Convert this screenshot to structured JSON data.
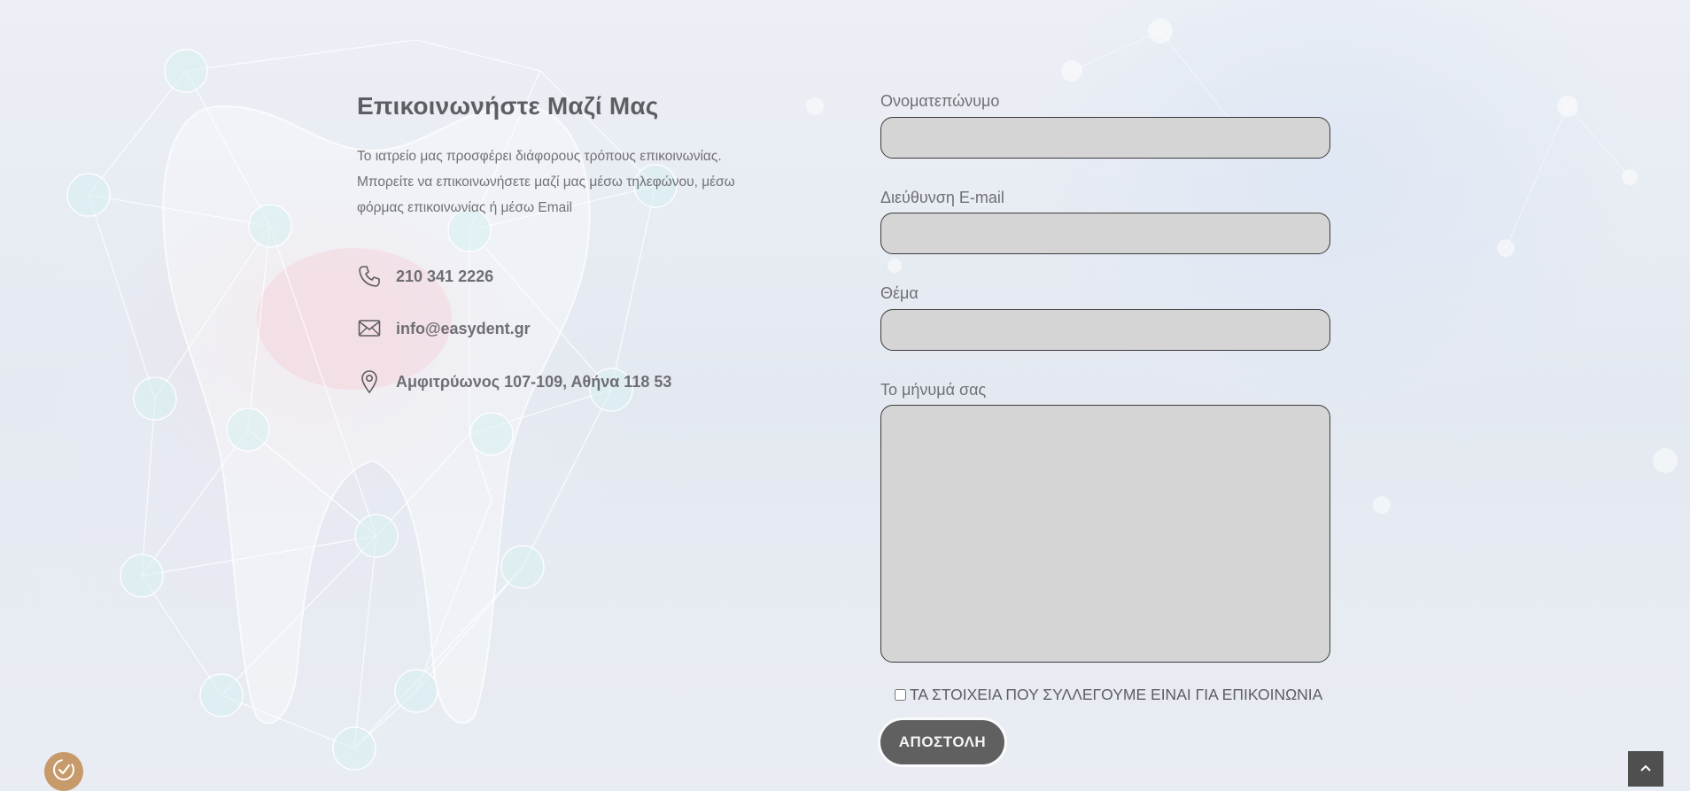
{
  "contact": {
    "title": "Επικοινωνήστε Μαζί Μας",
    "intro": "Το ιατρείο μας προσφέρει διάφορους τρόπους επικοινωνίας. Μπορείτε να επικοινωνήσετε μαζί μας μέσω τηλεφώνου, μέσω φόρμας επικοινωνίας ή μέσω Email",
    "items": [
      {
        "icon": "phone-icon",
        "text": "210 341 2226"
      },
      {
        "icon": "envelope-icon",
        "text": "info@easydent.gr"
      },
      {
        "icon": "map-pin-icon",
        "text": "Αμφιτρύωνος 107-109, Αθήνα 118 53"
      }
    ]
  },
  "form": {
    "name_label": "Ονοματεπώνυμο",
    "name_value": "",
    "email_label": "Διεύθυνση E-mail",
    "email_value": "",
    "subject_label": "Θέμα",
    "subject_value": "",
    "message_label": "Το μήνυμά σας",
    "message_value": "",
    "consent_label": "ΤΑ ΣΤΟΙΧΕΙΑ ΠΟΥ ΣΥΛΛΕΓΟΥΜΕ ΕΙΝΑΙ ΓΙΑ ΕΠΙΚΟΙΝΩΝΙΑ",
    "consent_checked": false,
    "submit_label": "ΑΠΟΣΤΟΛΗ"
  },
  "widgets": {
    "accessibility_icon": "accessibility-icon",
    "scroll_top_icon": "chevron-up-icon"
  },
  "colors": {
    "heading": "#5e5e62",
    "input_fill": "#d5d5d5",
    "button": "#606060",
    "accessibility_badge": "#c79a6a"
  }
}
